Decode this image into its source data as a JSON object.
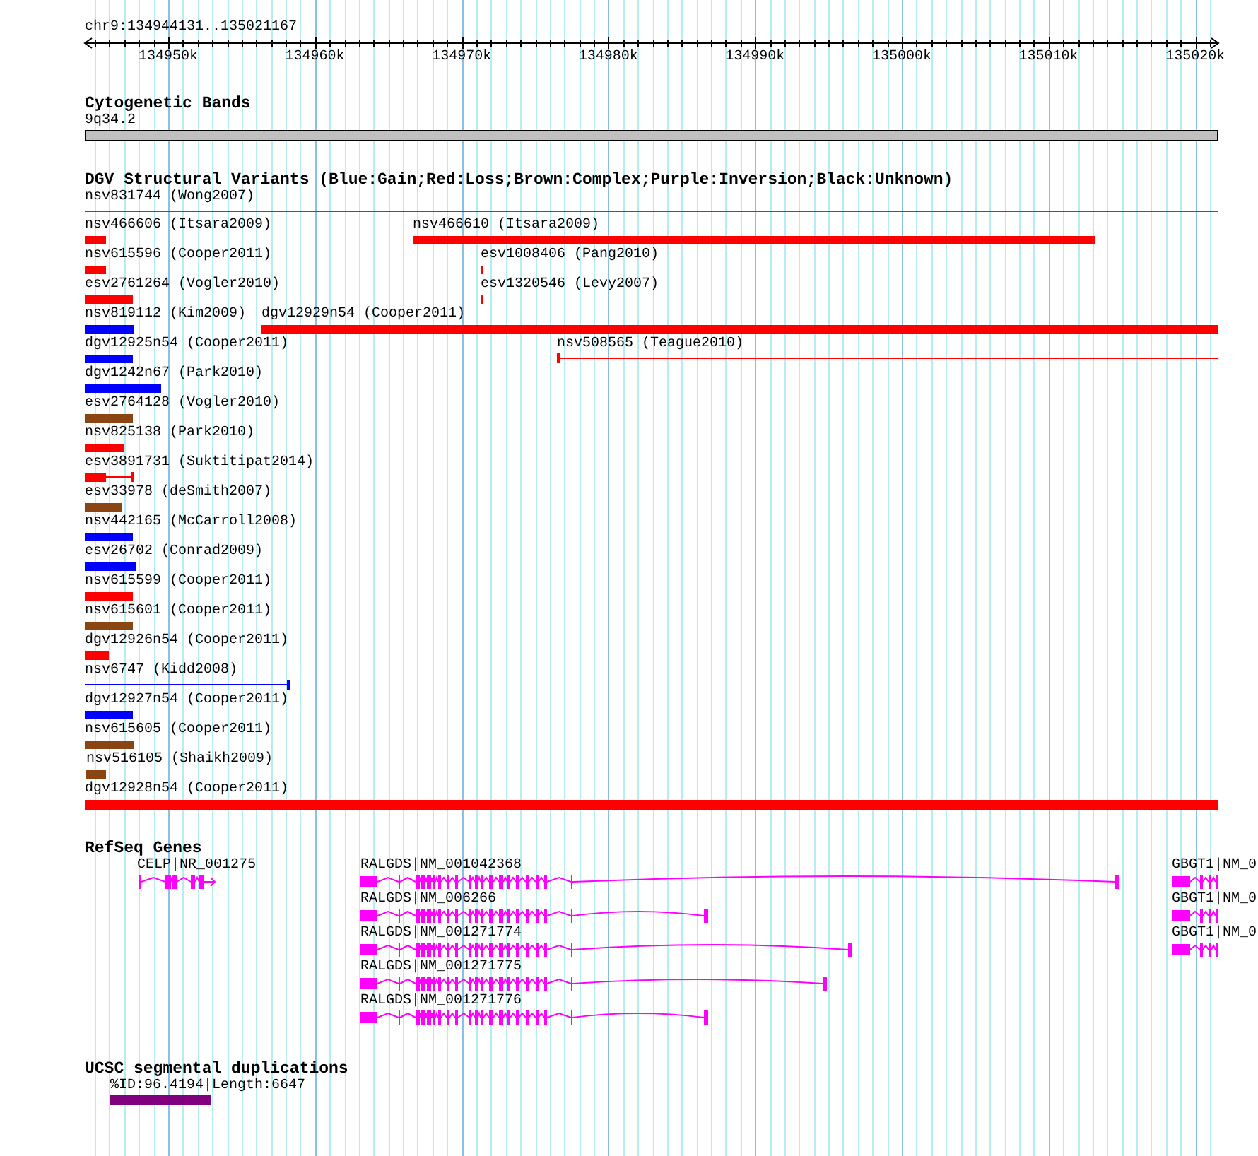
{
  "location": "chr9:134944131..135021167",
  "ruler": {
    "labels": [
      "134950k",
      "134960k",
      "134970k",
      "134980k",
      "134990k",
      "135000k",
      "135010k",
      "135020k"
    ]
  },
  "cytogenetic_bands": {
    "title": "Cytogenetic Bands",
    "band": "9q34.2"
  },
  "dgv": {
    "title": "DGV Structural Variants (Blue:Gain;Red:Loss;Brown:Complex;Purple:Inversion;Black:Unknown)",
    "rows": [
      {
        "features": [
          {
            "label": "nsv831744 (Wong2007)",
            "kind": "line",
            "color": "#8b4513"
          }
        ]
      },
      {
        "features": [
          {
            "label": "nsv466606 (Itsara2009)",
            "kind": "block",
            "color": "#ff0000"
          },
          {
            "label": "nsv466610 (Itsara2009)",
            "kind": "block",
            "color": "#ff0000"
          }
        ]
      },
      {
        "features": [
          {
            "label": "nsv615596 (Cooper2011)",
            "kind": "block",
            "color": "#ff0000"
          },
          {
            "label": "esv1008406 (Pang2010)",
            "kind": "block",
            "color": "#ff0000"
          }
        ]
      },
      {
        "features": [
          {
            "label": "esv2761264 (Vogler2010)",
            "kind": "block",
            "color": "#ff0000"
          },
          {
            "label": "esv1320546 (Levy2007)",
            "kind": "block",
            "color": "#ff0000"
          }
        ]
      },
      {
        "features": [
          {
            "label": "nsv819112 (Kim2009)",
            "kind": "block",
            "color": "#0000ff"
          },
          {
            "label": "dgv12929n54 (Cooper2011)",
            "kind": "block",
            "color": "#ff0000"
          }
        ]
      },
      {
        "features": [
          {
            "label": "dgv12925n54 (Cooper2011)",
            "kind": "block",
            "color": "#0000ff"
          },
          {
            "label": "nsv508565 (Teague2010)",
            "kind": "line",
            "color": "#ff0000"
          }
        ]
      },
      {
        "features": [
          {
            "label": "dgv1242n67 (Park2010)",
            "kind": "block",
            "color": "#0000ff"
          }
        ]
      },
      {
        "features": [
          {
            "label": "esv2764128 (Vogler2010)",
            "kind": "block",
            "color": "#8b4513"
          }
        ]
      },
      {
        "features": [
          {
            "label": "nsv825138 (Park2010)",
            "kind": "block",
            "color": "#ff0000"
          }
        ]
      },
      {
        "features": [
          {
            "label": "esv3891731 (Suktitipat2014)",
            "kind": "block_line",
            "color": "#ff0000"
          }
        ]
      },
      {
        "features": [
          {
            "label": "esv33978 (deSmith2007)",
            "kind": "block",
            "color": "#8b4513"
          }
        ]
      },
      {
        "features": [
          {
            "label": "nsv442165 (McCarroll2008)",
            "kind": "block",
            "color": "#0000ff"
          }
        ]
      },
      {
        "features": [
          {
            "label": "esv26702 (Conrad2009)",
            "kind": "block",
            "color": "#0000ff"
          }
        ]
      },
      {
        "features": [
          {
            "label": "nsv615599 (Cooper2011)",
            "kind": "block",
            "color": "#ff0000"
          }
        ]
      },
      {
        "features": [
          {
            "label": "nsv615601 (Cooper2011)",
            "kind": "block",
            "color": "#8b4513"
          }
        ]
      },
      {
        "features": [
          {
            "label": "dgv12926n54 (Cooper2011)",
            "kind": "block",
            "color": "#ff0000"
          }
        ]
      },
      {
        "features": [
          {
            "label": "nsv6747 (Kidd2008)",
            "kind": "line",
            "color": "#0000ff"
          }
        ]
      },
      {
        "features": [
          {
            "label": "dgv12927n54 (Cooper2011)",
            "kind": "block",
            "color": "#0000ff"
          }
        ]
      },
      {
        "features": [
          {
            "label": "nsv615605 (Cooper2011)",
            "kind": "block",
            "color": "#8b4513"
          }
        ]
      },
      {
        "features": [
          {
            "label": "nsv516105 (Shaikh2009)",
            "kind": "block",
            "color": "#8b4513"
          }
        ]
      },
      {
        "features": [
          {
            "label": "dgv12928n54 (Cooper2011)",
            "kind": "block",
            "color": "#ff0000"
          }
        ]
      }
    ]
  },
  "refseq_genes": {
    "title": "RefSeq Genes",
    "rows": [
      {
        "genes": [
          {
            "label": "CELP|NR_001275"
          },
          {
            "label": "RALGDS|NM_001042368"
          },
          {
            "label": "GBGT1|NM_0"
          }
        ]
      },
      {
        "genes": [
          {
            "label": "RALGDS|NM_006266"
          },
          {
            "label": "GBGT1|NM_0"
          }
        ]
      },
      {
        "genes": [
          {
            "label": "RALGDS|NM_001271774"
          },
          {
            "label": "GBGT1|NM_0"
          }
        ]
      },
      {
        "genes": [
          {
            "label": "RALGDS|NM_001271775"
          }
        ]
      },
      {
        "genes": [
          {
            "label": "RALGDS|NM_001271776"
          }
        ]
      }
    ]
  },
  "segmental_duplications": {
    "title": "UCSC segmental duplications",
    "features": [
      {
        "label": "%ID:96.4194|Length:6647",
        "color": "#800080"
      }
    ]
  }
}
